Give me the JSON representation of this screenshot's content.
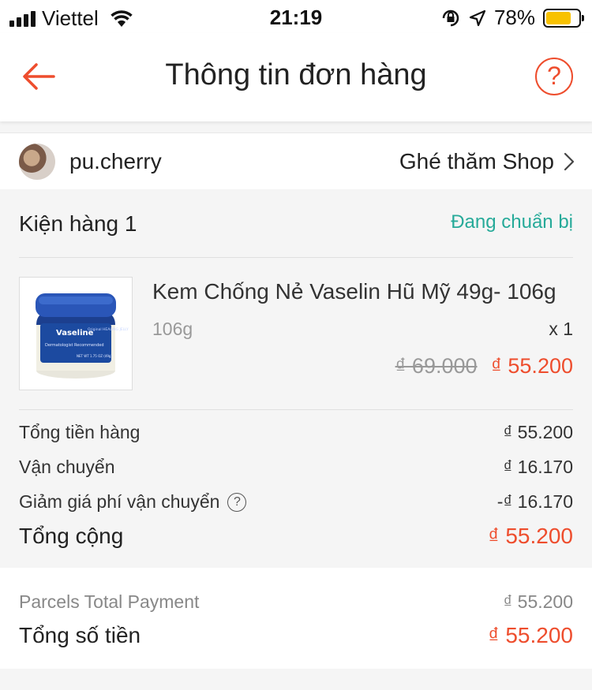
{
  "status_bar": {
    "carrier": "Viettel",
    "time": "21:19",
    "battery_percent": "78%",
    "battery_level": 0.78,
    "battery_color": "#f8c200"
  },
  "nav": {
    "title": "Thông tin đơn hàng",
    "back_icon": "back-arrow-icon",
    "help_icon": "help-icon",
    "help_glyph": "?"
  },
  "shop": {
    "name": "pu.cherry",
    "visit_label": "Ghé thăm Shop",
    "chevron_icon": "chevron-right-icon"
  },
  "parcel": {
    "title": "Kiện hàng 1",
    "status": "Đang chuẩn bị",
    "status_color": "#26aa99",
    "product": {
      "name": "Kem Chống Nẻ Vaselin Hũ Mỹ 49g- 106g",
      "variant": "106g",
      "quantity": "x 1",
      "original_price": "₫ 69.000",
      "price": "₫ 55.200",
      "thumbnail_brand": "Vaseline",
      "thumbnail_subtext": "Original HEALING JELLY",
      "thumbnail_tagline": "Dermatologist Recommended",
      "thumbnail_net": "NET WT 1.75 OZ (49g)"
    },
    "summary": {
      "subtotal_label": "Tổng tiền hàng",
      "subtotal_value": "₫ 55.200",
      "shipping_label": "Vận chuyển",
      "shipping_value": "₫ 16.170",
      "shipping_discount_label": "Giảm giá phí vận chuyển",
      "shipping_discount_value": "-₫ 16.170",
      "info_glyph": "?",
      "total_label": "Tổng cộng",
      "total_value": "₫ 55.200"
    }
  },
  "payment": {
    "parcels_label": "Parcels Total Payment",
    "parcels_value": "₫ 55.200",
    "grand_label": "Tổng số tiền",
    "grand_value": "₫ 55.200"
  },
  "colors": {
    "accent": "#ee4d2d",
    "status_green": "#26aa99"
  }
}
